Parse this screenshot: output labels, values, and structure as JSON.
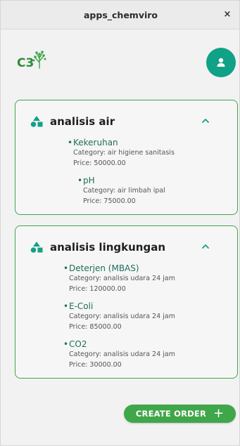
{
  "window": {
    "title": "apps_chemviro",
    "close_label": "×"
  },
  "header": {
    "logo_text": "C3",
    "avatar_icon": "person-icon"
  },
  "categories": [
    {
      "title": "analisis air",
      "items": [
        {
          "name": "Kekeruhan",
          "category": "Category: air higiene sanitasis",
          "price": "Price: 50000.00"
        },
        {
          "name": "pH",
          "category": "Category: air limbah ipal",
          "price": "Price: 75000.00"
        }
      ]
    },
    {
      "title": "analisis lingkungan",
      "items": [
        {
          "name": "Deterjen (MBAS)",
          "category": "Category: analisis udara 24 jam",
          "price": "Price: 120000.00"
        },
        {
          "name": "E-Coli",
          "category": "Category: analisis udara 24 jam",
          "price": "Price: 85000.00"
        },
        {
          "name": "CO2",
          "category": "Category: analisis udara 24 jam",
          "price": "Price: 30000.00"
        }
      ]
    }
  ],
  "actions": {
    "create_order_label": "CREATE ORDER",
    "create_order_icon": "+"
  },
  "colors": {
    "accent": "#3fa64a",
    "teal": "#10a186",
    "item_text": "#1e6e5b"
  }
}
